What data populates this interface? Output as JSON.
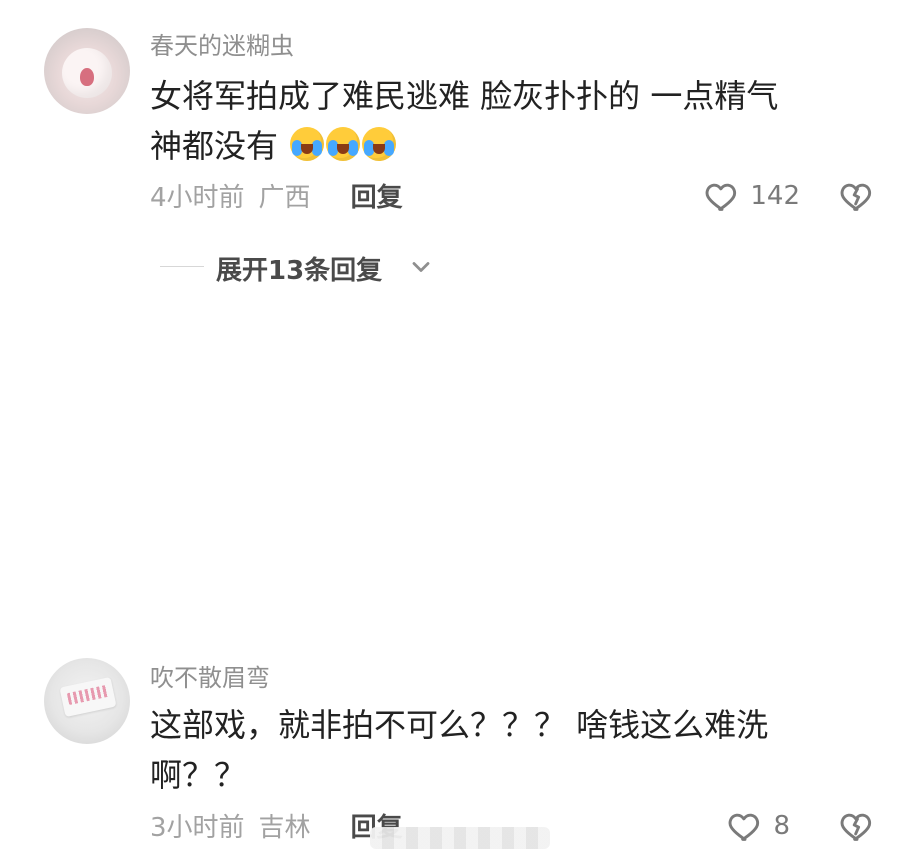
{
  "comments": [
    {
      "username": "春天的迷糊虫",
      "text_line1": "女将军拍成了难民逃难  脸灰扑扑的  一点精气",
      "text_line2": "神都没有",
      "emoji_count": 3,
      "time": "4小时前",
      "location": "广西",
      "reply_label": "回复",
      "likes": "142",
      "avatar_icon": "crying-cat-avatar",
      "like_icon": "heart-outline-icon",
      "dislike_icon": "broken-heart-icon",
      "expand_label": "展开13条回复"
    },
    {
      "username": "吹不散眉弯",
      "text_line1": "这部戏，就非拍不可么？？？ 啥钱这么难洗",
      "text_line2": "啊？？",
      "time": "3小时前",
      "location": "吉林",
      "reply_label": "回复",
      "likes": "8",
      "avatar_icon": "paper-stamp-avatar",
      "like_icon": "heart-outline-icon",
      "dislike_icon": "broken-heart-icon"
    }
  ],
  "colors": {
    "username": "#8f8f8f",
    "meta": "#a2a2a2",
    "primary_text": "#222222",
    "secondary_text": "#4a4a4a",
    "icon": "#7a7a7a"
  }
}
